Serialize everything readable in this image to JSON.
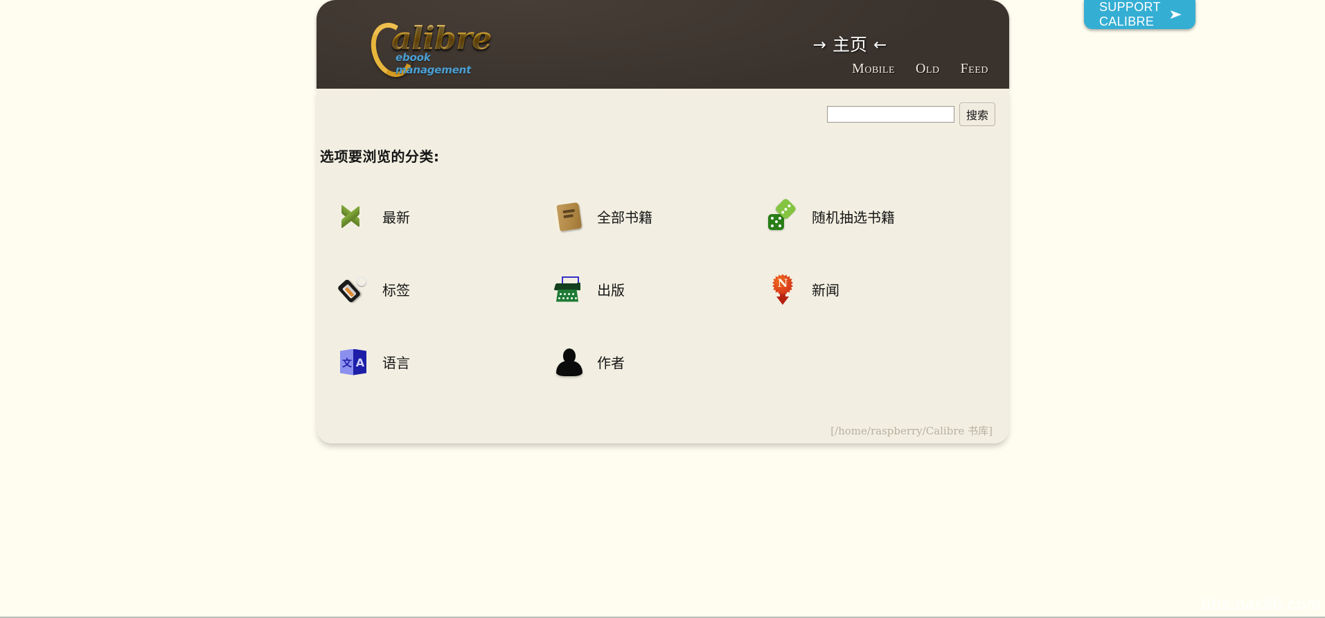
{
  "header": {
    "logo_text": "alibre",
    "logo_sub": "ebook management",
    "home_arrow_left": "→",
    "home_title": "主页",
    "home_arrow_right": "←",
    "support_label": "SUPPORT CALIBRE",
    "support_caret": "➤",
    "nav": [
      {
        "label": "Mobile",
        "name": "nav-mobile"
      },
      {
        "label": "Old",
        "name": "nav-old"
      },
      {
        "label": "Feed",
        "name": "nav-feed"
      }
    ]
  },
  "search": {
    "value": "",
    "placeholder": "",
    "button_label": "搜索"
  },
  "main": {
    "browse_heading": "选项要浏览的分类:",
    "categories": [
      {
        "label": "最新",
        "icon": "chevron-right-icon"
      },
      {
        "label": "全部书籍",
        "icon": "book-icon"
      },
      {
        "label": "随机抽选书籍",
        "icon": "dice-icon"
      },
      {
        "label": "标签",
        "icon": "tag-icon"
      },
      {
        "label": "出版",
        "icon": "typewriter-icon"
      },
      {
        "label": "新闻",
        "icon": "news-icon"
      },
      {
        "label": "语言",
        "icon": "language-icon"
      },
      {
        "label": "作者",
        "icon": "person-icon"
      }
    ]
  },
  "footer": {
    "library_path": "[/home/raspberry/Calibre 书库]"
  },
  "watermark": {
    "text": "bbs.nas66.com"
  },
  "icons": {
    "language_glyph_left": "文",
    "language_glyph_right": "A",
    "news_letter": "N"
  },
  "colors": {
    "header_bg": "#3a322c",
    "panel_bg": "#f2efe2",
    "page_bg": "#fffdf0",
    "support_blue": "#35aed4",
    "logo_gold": "#e0a828",
    "logo_sub_blue": "#4a9fd4"
  }
}
